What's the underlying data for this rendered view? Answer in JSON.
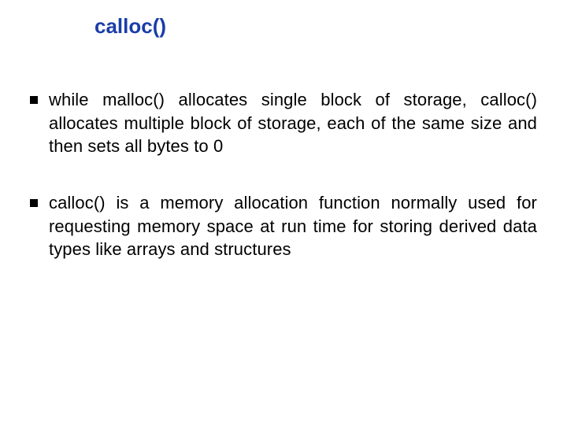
{
  "title": "calloc()",
  "bullets": [
    "while malloc() allocates single block of storage, calloc() allocates multiple block of storage, each of the same size and then sets all bytes to 0",
    "calloc() is a memory allocation function normally used for requesting memory space at run time for storing derived data types like arrays and structures"
  ]
}
